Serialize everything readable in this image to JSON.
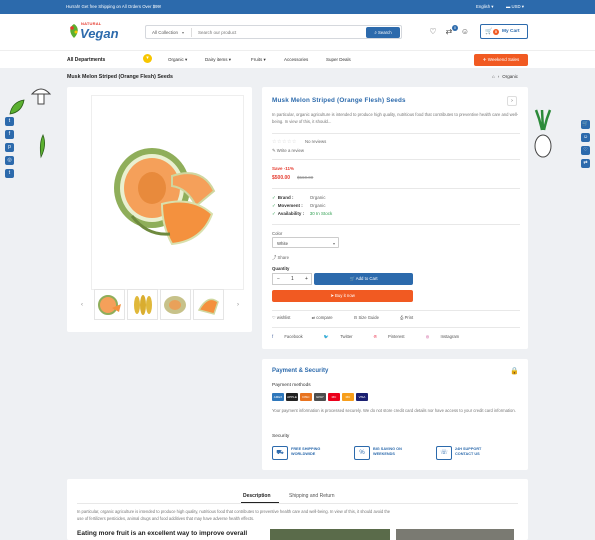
{
  "topbar": {
    "promo": "Hurrah! Get free Shipping on All Orders Over $99!",
    "language": "English",
    "currency": "USD"
  },
  "header": {
    "logo_top": "NATURAL",
    "logo_brand": "Vegan",
    "search_category": "All Collection",
    "search_placeholder": "Search our product",
    "search_button": "Search",
    "compare_count": "0",
    "cart_count": "0",
    "cart_label": "My Cart"
  },
  "nav": {
    "departments": "All Departments",
    "items": [
      "Organic",
      "Dairy items",
      "Fruits",
      "Accessories",
      "Super Deals"
    ],
    "weekend": "Weekend Sales"
  },
  "breadcrumb": {
    "title": "Musk Melon Striped (Orange Flesh) Seeds",
    "path": [
      "Organic"
    ]
  },
  "product": {
    "title": "Musk Melon Striped (Orange Flesh) Seeds",
    "description": "In particular, organic agriculture is intended to produce high quality, nutritious food that contributes to preventive health care and well-being. In view of this, it should...",
    "reviews": "No reviews",
    "write_review": "Write a review",
    "save": "Save -11%",
    "price": "$500.00",
    "old_price": "$560.00",
    "brand_label": "Brand :",
    "brand": "Organic",
    "movement_label": "Movement :",
    "movement": "Organic",
    "availability_label": "Availability :",
    "availability": "30 In Stock",
    "color_label": "Color",
    "color_value": "White",
    "share": "Share",
    "quantity_label": "Quantity",
    "quantity": "1",
    "add_to_cart": "Add to Cart",
    "buy_now": "Buy it now",
    "actions": [
      "wishlist",
      "compare",
      "Size Guide",
      "Print"
    ],
    "social": [
      "Facebook",
      "Twitter",
      "Pinterest",
      "Instagram"
    ]
  },
  "payment": {
    "title": "Payment & Security",
    "methods_label": "Payment methods",
    "cards": [
      {
        "name": "AMEX",
        "color": "#2e77bb"
      },
      {
        "name": "APPLE",
        "color": "#222222"
      },
      {
        "name": "DISC",
        "color": "#e8731f"
      },
      {
        "name": "GPAY",
        "color": "#4d4d4d"
      },
      {
        "name": "MC",
        "color": "#eb001b"
      },
      {
        "name": "MC",
        "color": "#f79e1b"
      },
      {
        "name": "VISA",
        "color": "#1a1f71"
      }
    ],
    "note": "Your payment information is processed securely. We do not store credit card details nor have access to your credit card information.",
    "security_label": "Security",
    "features": [
      {
        "icon": "truck-icon",
        "text": "FREE SHIPPING WORLDWIDE"
      },
      {
        "icon": "percent-icon",
        "text": "BIG SAVING ON WEEKENDS"
      },
      {
        "icon": "support-icon",
        "text": "24H SUPPORT CONTACT US"
      }
    ]
  },
  "tabs": {
    "description": "Description",
    "shipping": "Shipping and Return",
    "body": "In particular, organic agriculture is intended to produce high quality, nutritious food that contributes to preventive health care and well-being. In view of this, it should avoid the use of fertilizers pesticides, animal drugs and food additives that may have adverse health effects.",
    "heading": "Eating more fruit is an excellent way to improve overall"
  },
  "colors": {
    "primary": "#2c6aac",
    "accent": "#f15a22",
    "sale": "#e53b2f",
    "stock": "#2e9e4f"
  }
}
